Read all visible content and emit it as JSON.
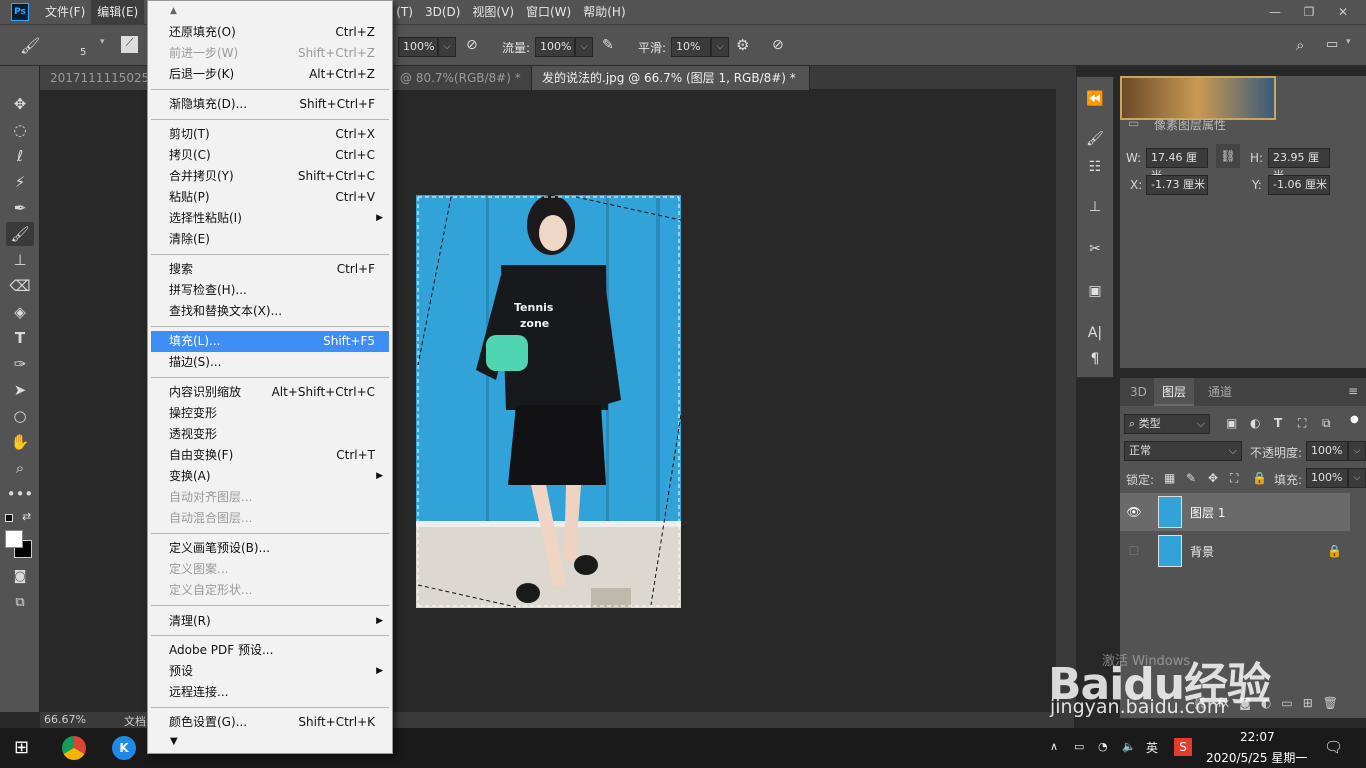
{
  "menubar": {
    "logo": "Ps",
    "items": [
      "文件(F)",
      "编辑(E)",
      "(T)",
      "3D(D)",
      "视图(V)",
      "窗口(W)",
      "帮助(H)"
    ],
    "window_controls": [
      "—",
      "❐",
      "✕"
    ]
  },
  "options_bar": {
    "brush_size": "5",
    "opacity_value": "100%",
    "flow_label": "流量:",
    "flow_value": "100%",
    "smoothing_label": "平滑:",
    "smoothing_value": "10%"
  },
  "doc_tabs": [
    {
      "label": "20171111150255",
      "active": false
    },
    {
      "label": "@ 80.7%(RGB/8#) *",
      "active": false
    },
    {
      "label": "发的说法的.jpg @ 66.7% (图层 1, RGB/8#) *",
      "active": true
    }
  ],
  "edit_menu": {
    "items": [
      {
        "label": "还原填充(O)",
        "shortcut": "Ctrl+Z",
        "disabled": false
      },
      {
        "label": "前进一步(W)",
        "shortcut": "Shift+Ctrl+Z",
        "disabled": true
      },
      {
        "label": "后退一步(K)",
        "shortcut": "Alt+Ctrl+Z",
        "disabled": false
      },
      {
        "label": "渐隐填充(D)...",
        "shortcut": "Shift+Ctrl+F",
        "disabled": false
      },
      {
        "label": "剪切(T)",
        "shortcut": "Ctrl+X",
        "disabled": false
      },
      {
        "label": "拷贝(C)",
        "shortcut": "Ctrl+C",
        "disabled": false
      },
      {
        "label": "合并拷贝(Y)",
        "shortcut": "Shift+Ctrl+C",
        "disabled": false
      },
      {
        "label": "粘贴(P)",
        "shortcut": "Ctrl+V",
        "disabled": false
      },
      {
        "label": "选择性粘贴(I)",
        "shortcut": "",
        "submenu": true
      },
      {
        "label": "清除(E)",
        "shortcut": ""
      },
      {
        "label": "搜索",
        "shortcut": "Ctrl+F"
      },
      {
        "label": "拼写检查(H)...",
        "shortcut": ""
      },
      {
        "label": "查找和替换文本(X)...",
        "shortcut": ""
      },
      {
        "label": "填充(L)...",
        "shortcut": "Shift+F5",
        "highlighted": true
      },
      {
        "label": "描边(S)...",
        "shortcut": ""
      },
      {
        "label": "内容识别缩放",
        "shortcut": "Alt+Shift+Ctrl+C"
      },
      {
        "label": "操控变形",
        "shortcut": ""
      },
      {
        "label": "透视变形",
        "shortcut": ""
      },
      {
        "label": "自由变换(F)",
        "shortcut": "Ctrl+T"
      },
      {
        "label": "变换(A)",
        "shortcut": "",
        "submenu": true
      },
      {
        "label": "自动对齐图层...",
        "shortcut": "",
        "disabled": true
      },
      {
        "label": "自动混合图层...",
        "shortcut": "",
        "disabled": true
      },
      {
        "label": "定义画笔预设(B)...",
        "shortcut": ""
      },
      {
        "label": "定义图案...",
        "shortcut": "",
        "disabled": true
      },
      {
        "label": "定义自定形状...",
        "shortcut": "",
        "disabled": true
      },
      {
        "label": "清理(R)",
        "shortcut": "",
        "submenu": true
      },
      {
        "label": "Adobe PDF 预设...",
        "shortcut": ""
      },
      {
        "label": "预设",
        "shortcut": "",
        "submenu": true
      },
      {
        "label": "远程连接...",
        "shortcut": ""
      },
      {
        "label": "颜色设置(G)...",
        "shortcut": "Shift+Ctrl+K"
      }
    ],
    "scroll_up": "▲",
    "scroll_down": "▼"
  },
  "properties": {
    "title": "像素图层属性",
    "w_label": "W:",
    "w_value": "17.46 厘米",
    "h_label": "H:",
    "h_value": "23.95 厘米",
    "x_label": "X:",
    "x_value": "-1.73 厘米",
    "y_label": "Y:",
    "y_value": "-1.06 厘米"
  },
  "layers_panel": {
    "tabs": [
      "3D",
      "图层",
      "通道"
    ],
    "active_tab": "图层",
    "filter_kind": "类型",
    "blend_mode": "正常",
    "opacity_label": "不透明度:",
    "opacity_value": "100%",
    "lock_label": "锁定:",
    "fill_label": "填充:",
    "fill_value": "100%",
    "layers": [
      {
        "name": "图层 1",
        "visible": true,
        "selected": true,
        "locked": false
      },
      {
        "name": "背景",
        "visible": false,
        "selected": false,
        "locked": true
      }
    ]
  },
  "status": {
    "zoom": "66.67%",
    "doc_label": "文档"
  },
  "watermark": {
    "text": "Baidu经验",
    "url": "jingyan.baidu.com",
    "activate_text": "激活 Windows"
  },
  "taskbar": {
    "ime": "英",
    "time": "22:07",
    "date": "2020/5/25 星期一"
  },
  "colors": {
    "panel": "#535353",
    "dark": "#282828",
    "highlight": "#3e8ef7",
    "photo_bg": "#31a3d8"
  }
}
